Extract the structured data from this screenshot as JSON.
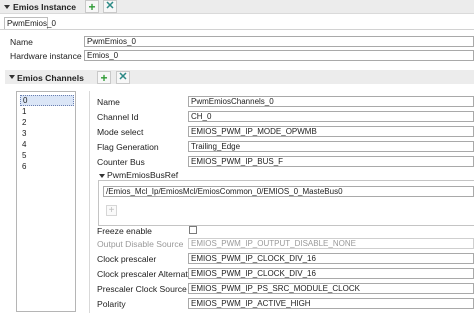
{
  "header": {
    "title": "Emios Instance"
  },
  "tab": {
    "label": "PwmEmios_0"
  },
  "instance": {
    "name_label": "Name",
    "name_value": "PwmEmios_0",
    "hw_label": "Hardware instance",
    "hw_value": "Emios_0"
  },
  "channels": {
    "title": "Emios Channels",
    "items": [
      "0",
      "1",
      "2",
      "3",
      "4",
      "5",
      "6"
    ],
    "selected_index": 0
  },
  "channel": {
    "name_label": "Name",
    "name_value": "PwmEmiosChannels_0",
    "chid_label": "Channel Id",
    "chid_value": "CH_0",
    "mode_label": "Mode select",
    "mode_value": "EMIOS_PWM_IP_MODE_OPWMB",
    "flag_label": "Flag Generation",
    "flag_value": "Trailing_Edge",
    "bus_label": "Counter Bus",
    "bus_value": "EMIOS_PWM_IP_BUS_F",
    "busref_title": "PwmEmiosBusRef",
    "busref_value": "/Emios_Mcl_Ip/EmiosMcl/EmiosCommon_0/EMIOS_0_MasteBus0",
    "freeze_label": "Freeze enable",
    "freeze_checked": false,
    "ods_label": "Output Disable Source",
    "ods_value": "EMIOS_PWM_IP_OUTPUT_DISABLE_NONE",
    "clkpre_label": "Clock prescaler",
    "clkpre_value": "EMIOS_PWM_IP_CLOCK_DIV_16",
    "clkalt_label": "Clock prescaler Alternate",
    "clkalt_value": "EMIOS_PWM_IP_CLOCK_DIV_16",
    "presrc_label": "Prescaler Clock Source",
    "presrc_value": "EMIOS_PWM_IP_PS_SRC_MODULE_CLOCK",
    "pol_label": "Polarity",
    "pol_value": "EMIOS_PWM_IP_ACTIVE_HIGH"
  },
  "icons": {
    "add": "plus-icon",
    "remove": "x-icon",
    "collapse": "triangle-down-icon",
    "add_glyph": "+",
    "remove_glyph": "✕"
  },
  "colors": {
    "add_green": "#2e9a34",
    "remove_teal": "#2d8a86",
    "selection": "#dbe6f7"
  }
}
